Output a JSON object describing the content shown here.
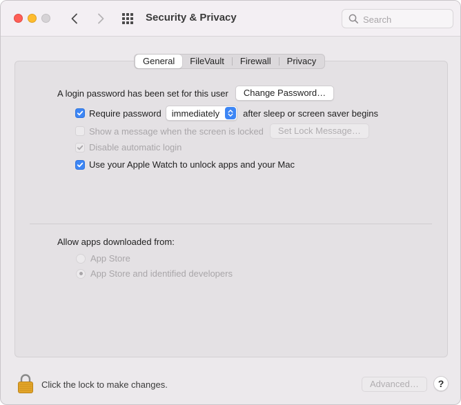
{
  "window": {
    "title": "Security & Privacy",
    "search_placeholder": "Search"
  },
  "tabs": [
    {
      "label": "General",
      "active": true
    },
    {
      "label": "FileVault",
      "active": false
    },
    {
      "label": "Firewall",
      "active": false
    },
    {
      "label": "Privacy",
      "active": false
    }
  ],
  "general": {
    "login_password_text": "A login password has been set for this user",
    "change_password_button": "Change Password…",
    "require_password": {
      "label": "Require password",
      "checked": true,
      "delay_value": "immediately",
      "suffix": "after sleep or screen saver begins"
    },
    "show_message": {
      "label": "Show a message when the screen is locked",
      "checked": false,
      "enabled": false,
      "button": "Set Lock Message…"
    },
    "disable_auto_login": {
      "label": "Disable automatic login",
      "checked": true,
      "enabled": false
    },
    "apple_watch": {
      "label": "Use your Apple Watch to unlock apps and your Mac",
      "checked": true
    }
  },
  "allow_apps": {
    "heading": "Allow apps downloaded from:",
    "options": [
      {
        "label": "App Store",
        "selected": false
      },
      {
        "label": "App Store and identified developers",
        "selected": true
      }
    ]
  },
  "footer": {
    "lock_text": "Click the lock to make changes.",
    "advanced_button": "Advanced…",
    "help_button": "?"
  },
  "colors": {
    "accent": "#3d86f5",
    "close": "#fe5f57",
    "minimize": "#febc2e",
    "lock": "#e3a52a"
  }
}
